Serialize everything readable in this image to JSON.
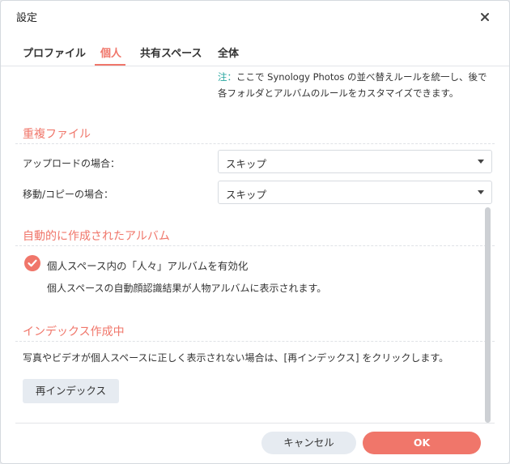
{
  "dialog": {
    "title": "設定",
    "close_icon": "close-icon"
  },
  "tabs": [
    {
      "label": "プロファイル",
      "active": false
    },
    {
      "label": "個人",
      "active": true
    },
    {
      "label": "共有スペース",
      "active": false
    },
    {
      "label": "全体",
      "active": false
    }
  ],
  "note": {
    "prefix": "注：",
    "text": "ここで Synology Photos の並べ替えルールを統一し、後で各フォルダとアルバムのルールをカスタマイズできます。"
  },
  "duplicates": {
    "heading": "重複ファイル",
    "upload_label": "アップロードの場合：",
    "upload_value": "スキップ",
    "move_copy_label": "移動/コピーの場合：",
    "move_copy_value": "スキップ"
  },
  "auto_albums": {
    "heading": "自動的に作成されたアルバム",
    "checkbox_label": "個人スペース内の「人々」アルバムを有効化",
    "checked": true,
    "description": "個人スペースの自動顔認識結果が人物アルバムに表示されます。"
  },
  "indexing": {
    "heading": "インデックス作成中",
    "description": "写真やビデオが個人スペースに正しく表示されない場合は、[再インデックス] をクリックします。",
    "reindex_button": "再インデックス"
  },
  "footer": {
    "cancel_label": "キャンセル",
    "ok_label": "OK"
  },
  "colors": {
    "accent": "#f0766a",
    "note_prefix": "#27a6a0",
    "secondary_button": "#e6ebf1"
  }
}
